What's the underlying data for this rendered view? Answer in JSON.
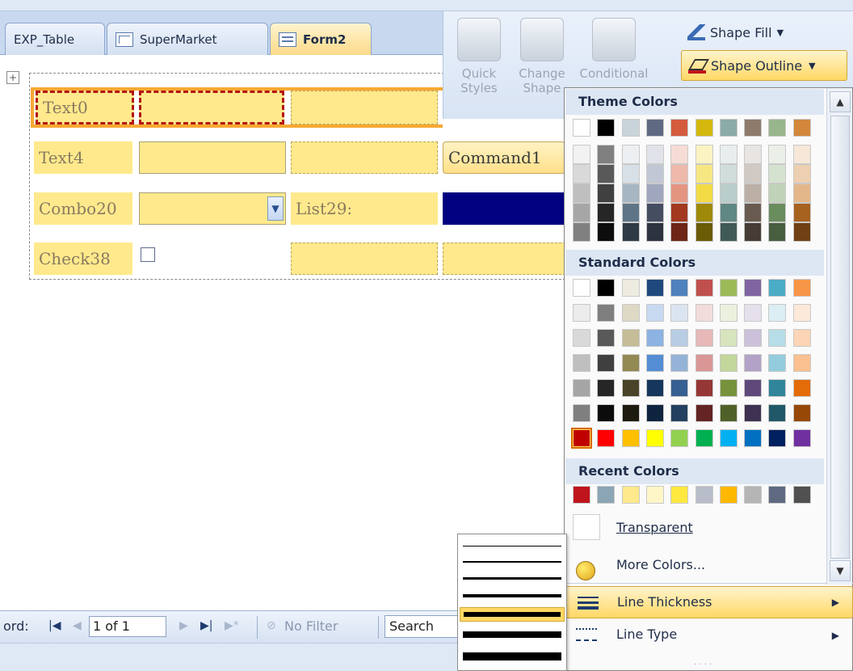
{
  "tabs": [
    {
      "label": "EXP_Table",
      "icon": "none",
      "active": false
    },
    {
      "label": "SuperMarket",
      "icon": "table-icon",
      "active": false
    },
    {
      "label": "Form2",
      "icon": "form-icon",
      "active": true
    }
  ],
  "form": {
    "labels": {
      "text0": "Text0",
      "text4": "Text4",
      "combo": "Combo20",
      "list": "List29:",
      "check": "Check38",
      "command": "Command1"
    }
  },
  "ribbon": {
    "quick_styles": "Quick Styles",
    "change_shape": "Change Shape",
    "conditional": "Conditional",
    "shape_fill": "Shape Fill",
    "shape_outline": "Shape Outline"
  },
  "color_menu": {
    "theme_header": "Theme Colors",
    "standard_header": "Standard Colors",
    "recent_header": "Recent Colors",
    "transparent": "Transparent",
    "more_colors": "More Colors...",
    "line_thickness": "Line Thickness",
    "line_type": "Line Type"
  },
  "colors": {
    "theme_top": [
      "#ffffff",
      "#000000",
      "#c9d3da",
      "#5f6a82",
      "#d45b3d",
      "#d4b80d",
      "#8aaba7",
      "#8d7a6b",
      "#97b68b",
      "#d2873b"
    ],
    "theme_columns": [
      [
        "#f2f2f2",
        "#d9d9d9",
        "#bfbfbf",
        "#a6a6a6",
        "#808080"
      ],
      [
        "#808080",
        "#595959",
        "#404040",
        "#262626",
        "#0d0d0d"
      ],
      [
        "#ecf0f3",
        "#d8e0e7",
        "#a6b6c3",
        "#5e7587",
        "#2f3b44"
      ],
      [
        "#e1e3ea",
        "#c2c7d5",
        "#a0a6bd",
        "#454d61",
        "#2e3340"
      ],
      [
        "#f6dcd5",
        "#eeb9ab",
        "#e49582",
        "#a3391f",
        "#6d2615"
      ],
      [
        "#fbf3c1",
        "#f7e783",
        "#f3db45",
        "#9f8909",
        "#6a5b06"
      ],
      [
        "#e8eeed",
        "#d0dddb",
        "#b9cdca",
        "#5f8783",
        "#405a57"
      ],
      [
        "#e8e4e1",
        "#d1c9c4",
        "#bbafa6",
        "#695b50",
        "#463c35"
      ],
      [
        "#eaf0e7",
        "#d5e2d0",
        "#c0d3b9",
        "#6a8d5e",
        "#475e3f"
      ],
      [
        "#f6e7d8",
        "#edcfb1",
        "#e4b78a",
        "#a76220",
        "#6f4115"
      ]
    ],
    "standard_rows": [
      [
        "#ffffff",
        "#000000",
        "#eeece1",
        "#1f497d",
        "#4f81bd",
        "#c0504d",
        "#9bbb59",
        "#8064a2",
        "#4bacc6",
        "#f79646"
      ],
      [
        "#ececec",
        "#7f7f7f",
        "#ddd9c4",
        "#c6d9f1",
        "#dbe5f1",
        "#f2dcdb",
        "#ebf1de",
        "#e5e0ec",
        "#dbeef4",
        "#fde9d9"
      ],
      [
        "#d9d9d9",
        "#595959",
        "#c4bd97",
        "#8db3e2",
        "#b8cce4",
        "#e6b9b8",
        "#d7e4bd",
        "#ccc1da",
        "#b7dee8",
        "#fbd5b5"
      ],
      [
        "#bfbfbf",
        "#3f3f3f",
        "#938953",
        "#548dd4",
        "#95b3d7",
        "#d99694",
        "#c3d69b",
        "#b2a2c7",
        "#93cddd",
        "#fac08f"
      ],
      [
        "#a5a5a5",
        "#262626",
        "#494429",
        "#17365d",
        "#366092",
        "#953734",
        "#76923c",
        "#5f497a",
        "#31859b",
        "#e36c09"
      ],
      [
        "#7f7f7f",
        "#0c0c0c",
        "#1d1b10",
        "#0f243e",
        "#244061",
        "#632423",
        "#4f6128",
        "#3f3151",
        "#205867",
        "#974806"
      ],
      [
        "#c00000",
        "#ff0000",
        "#ffc000",
        "#ffff00",
        "#92d050",
        "#00b050",
        "#00b0f0",
        "#0070c0",
        "#002060",
        "#7030a0"
      ]
    ],
    "recent": [
      "#c0141c",
      "#8ca5b5",
      "#ffe98c",
      "#fff6c8",
      "#ffe840",
      "#b8bdc9",
      "#ffb800",
      "#b5b5b5",
      "#5f6a82",
      "#505050"
    ],
    "selected_standard": "#c00000"
  },
  "status": {
    "record_prefix": "ord:",
    "record_value": "1 of 1",
    "no_filter": "No Filter",
    "search": "Search",
    "first_icon": "first-record-icon",
    "prev_icon": "prev-record-icon",
    "next_icon": "next-record-icon",
    "last_icon": "last-record-icon",
    "new_icon": "new-record-icon",
    "filter_icon": "filter-icon"
  },
  "line_thickness_options": [
    1,
    2,
    3,
    4,
    6,
    8,
    10
  ],
  "selected_thickness_index": 4
}
